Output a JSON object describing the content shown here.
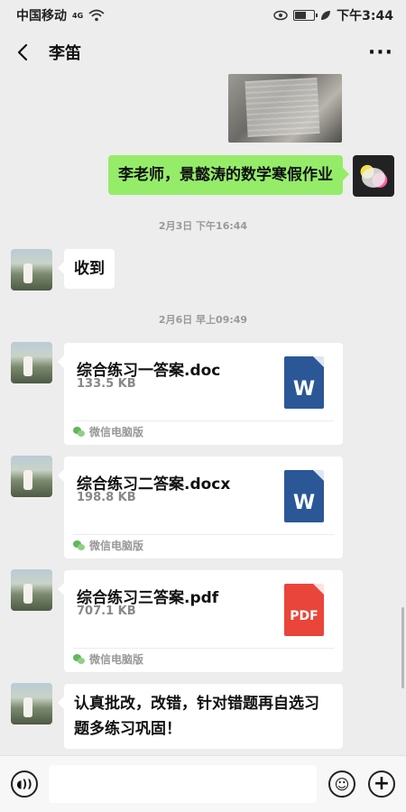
{
  "status": {
    "carrier": "中国移动",
    "network": "4G",
    "time": "下午3:44"
  },
  "header": {
    "contact": "李笛",
    "back_icon": "chevron-left-icon",
    "more_icon": "more-dots-icon"
  },
  "messages": {
    "m1": {
      "text": "李老师，景懿涛的数学寒假作业"
    },
    "t1": "2月3日 下午16:44",
    "m2": {
      "text": "收到"
    },
    "t2": "2月6日 早上09:49",
    "files": [
      {
        "name": "综合练习一答案.doc",
        "size": "133.5 KB",
        "type": "word",
        "icon_label": "W",
        "source": "微信电脑版"
      },
      {
        "name": "综合练习二答案.docx",
        "size": "198.8 KB",
        "type": "word",
        "icon_label": "W",
        "source": "微信电脑版"
      },
      {
        "name": "综合练习三答案.pdf",
        "size": "707.1 KB",
        "type": "pdf",
        "icon_label": "PDF",
        "source": "微信电脑版"
      }
    ],
    "m3": {
      "text": "认真批改，改错，针对错题再自选习题多练习巩固！"
    }
  },
  "input_bar": {
    "voice_icon": "voice-icon",
    "emoji_icon": "emoji-icon",
    "plus_icon": "plus-icon",
    "voice_glyph": "◖))",
    "emoji_glyph": "☺",
    "plus_glyph": "+"
  },
  "colors": {
    "bubble_self": "#95ec69",
    "background": "#ededed",
    "word": "#2b5797",
    "pdf": "#e9453a"
  }
}
